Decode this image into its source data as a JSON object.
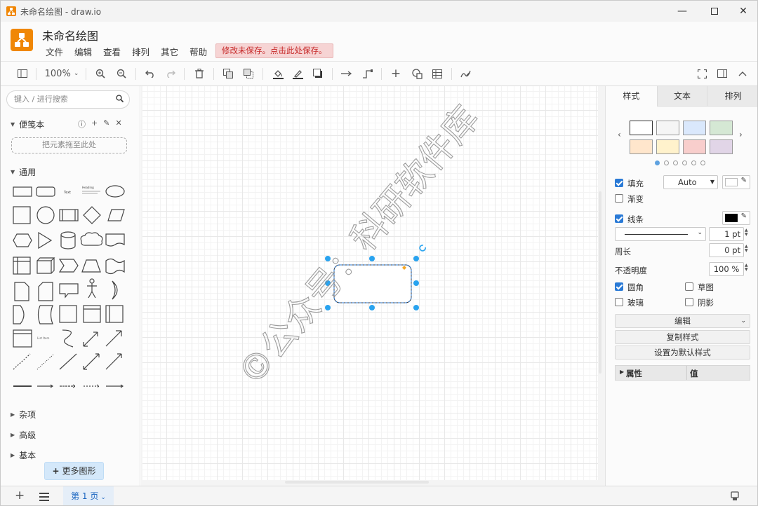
{
  "window": {
    "title": "未命名绘图 - draw.io"
  },
  "app": {
    "doc_title": "未命名绘图",
    "unsaved_notice": "修改未保存。点击此处保存。"
  },
  "menu": [
    "文件",
    "编辑",
    "查看",
    "排列",
    "其它",
    "帮助"
  ],
  "toolbar": {
    "zoom": "100%"
  },
  "left": {
    "search_placeholder": "键入 / 进行搜索",
    "scratchpad": "便笺本",
    "dropzone": "把元素拖至此处",
    "general": "通用",
    "shape_text": "Text",
    "shape_heading": "Heading",
    "shape_list": "List Item",
    "misc": "杂项",
    "advanced": "高级",
    "basic": "基本",
    "more_shapes": "更多图形"
  },
  "canvas": {
    "watermark": "©公众号：科研软件库"
  },
  "right": {
    "tabs": [
      "样式",
      "文本",
      "排列"
    ],
    "fill_label": "填充",
    "fill_value": "Auto",
    "gradient_label": "渐变",
    "line_label": "线条",
    "line_width": "1 pt",
    "perimeter_label": "周长",
    "perimeter_value": "0 pt",
    "opacity_label": "不透明度",
    "opacity_value": "100 %",
    "rounded_label": "圆角",
    "sketch_label": "草图",
    "glass_label": "玻璃",
    "shadow_label": "阴影",
    "edit_label": "编辑",
    "copy_style": "复制样式",
    "set_default": "设置为默认样式",
    "prop_col": "属性",
    "val_col": "值",
    "swatches": [
      "#ffffff",
      "#f5f5f5",
      "#dae8fc",
      "#d5e8d4",
      "#ffe6cc",
      "#fff2cc",
      "#f8cecc",
      "#e1d5e7"
    ]
  },
  "bottom": {
    "page_tab": "第 1 页"
  }
}
